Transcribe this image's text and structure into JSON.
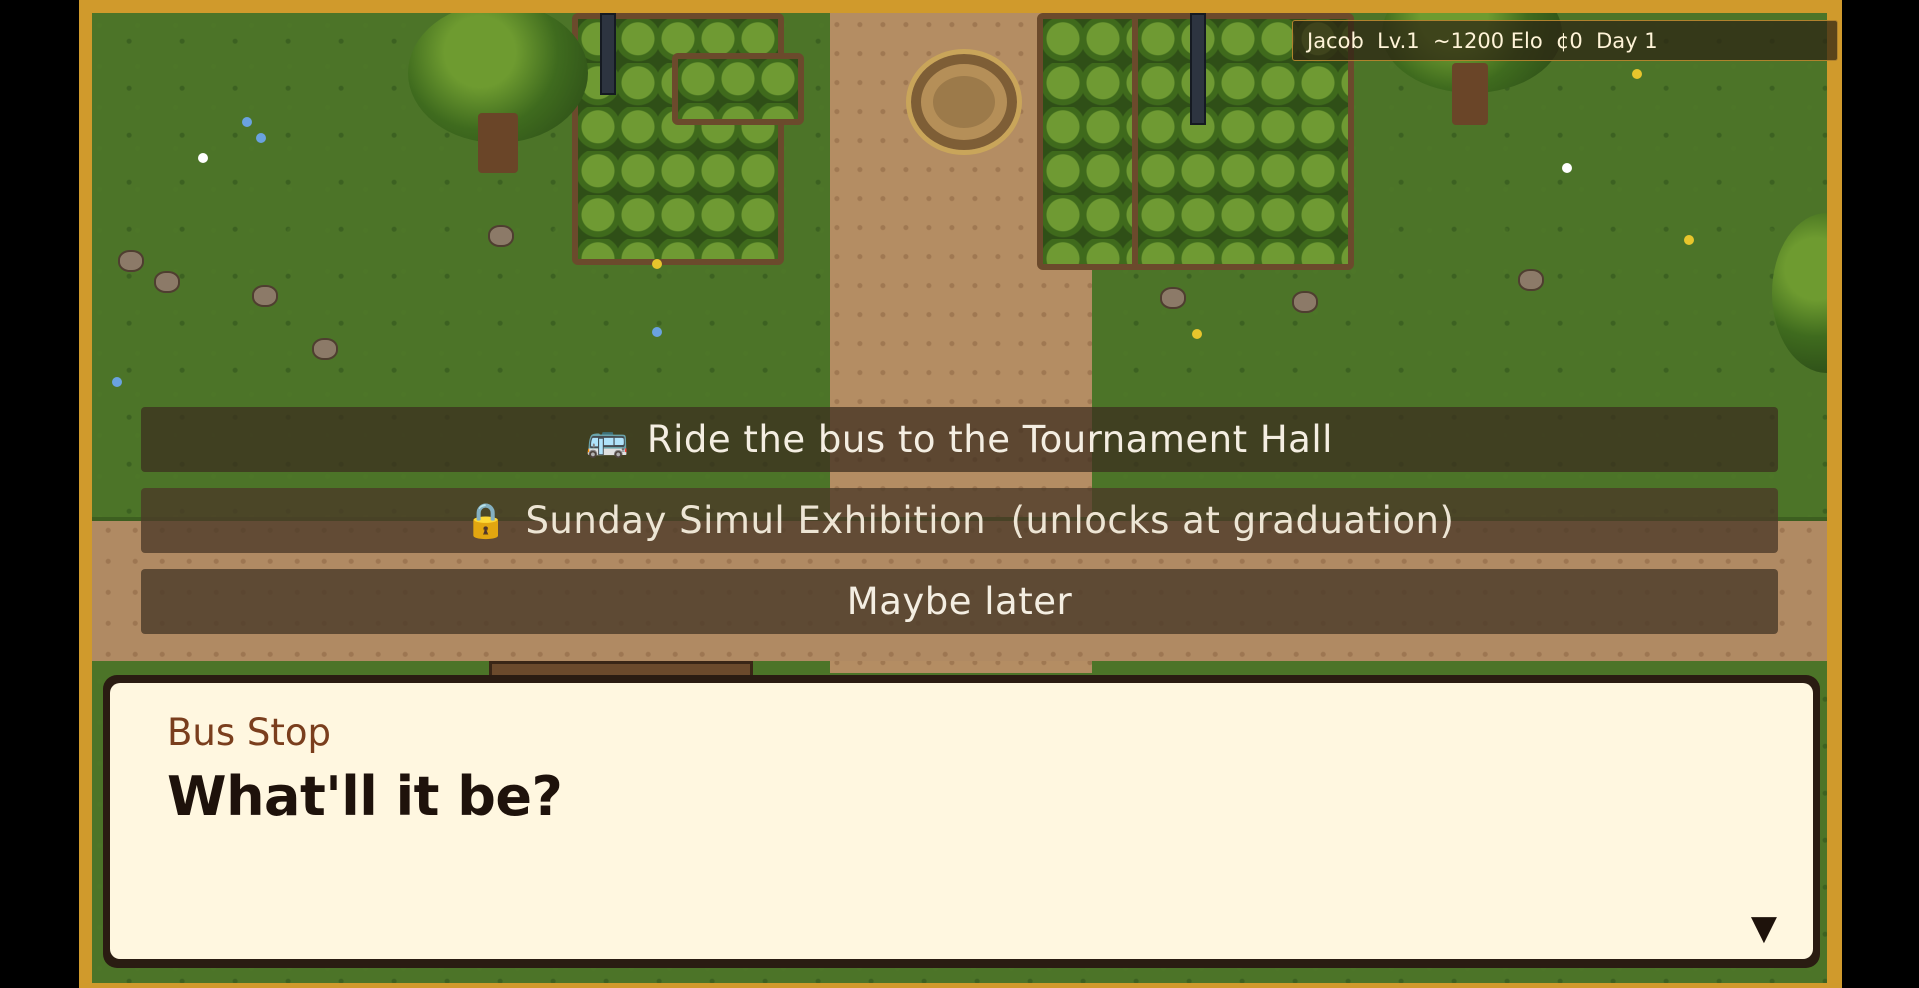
{
  "hud": {
    "text": "Jacob  Lv.1  ~1200 Elo  ¢0  Day 1"
  },
  "choices": [
    {
      "icon": "🚌",
      "icon_name": "bus-icon",
      "label": "Ride the bus to the Tournament Hall"
    },
    {
      "icon": "🔒",
      "icon_name": "lock-icon",
      "label": "Sunday Simul Exhibition  (unlocks at graduation)"
    },
    {
      "icon": "",
      "icon_name": "",
      "label": "Maybe later"
    }
  ],
  "dialog": {
    "speaker": "Bus Stop",
    "line": "What'll it be?",
    "advance_icon": "▼"
  },
  "colors": {
    "frame": "#d09a2c",
    "grass": "#4c7428",
    "path": "#b48d63",
    "dialog_bg": "#fff7e0",
    "speaker": "#7a3e1d"
  }
}
